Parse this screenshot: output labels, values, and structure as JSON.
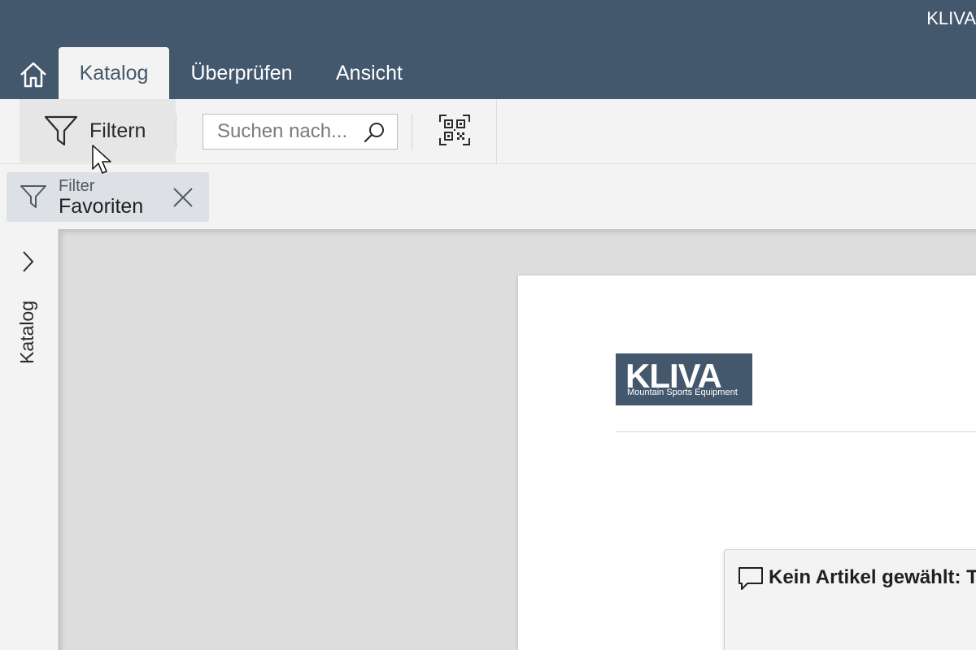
{
  "app": {
    "title": "KLIVA"
  },
  "tabs": [
    {
      "label": "Katalog",
      "active": true
    },
    {
      "label": "Überprüfen",
      "active": false
    },
    {
      "label": "Ansicht",
      "active": false
    }
  ],
  "ribbon": {
    "filter_label": "Filtern",
    "search_placeholder": "Suchen nach..."
  },
  "active_filter": {
    "category": "Filter",
    "value": "Favoriten"
  },
  "side_panel": {
    "label": "Katalog"
  },
  "document": {
    "logo_name": "KLIVA",
    "logo_tagline": "Mountain Sports Equipment"
  },
  "callout": {
    "text": "Kein Artikel gewählt: T"
  },
  "colors": {
    "header": "#44586d",
    "background": "#f3f3f3",
    "canvas": "#dddddd"
  },
  "icons": [
    "home-icon",
    "filter-icon",
    "search-icon",
    "qr-code-icon",
    "close-icon",
    "chevron-right-icon",
    "comment-icon",
    "mouse-cursor-icon"
  ]
}
